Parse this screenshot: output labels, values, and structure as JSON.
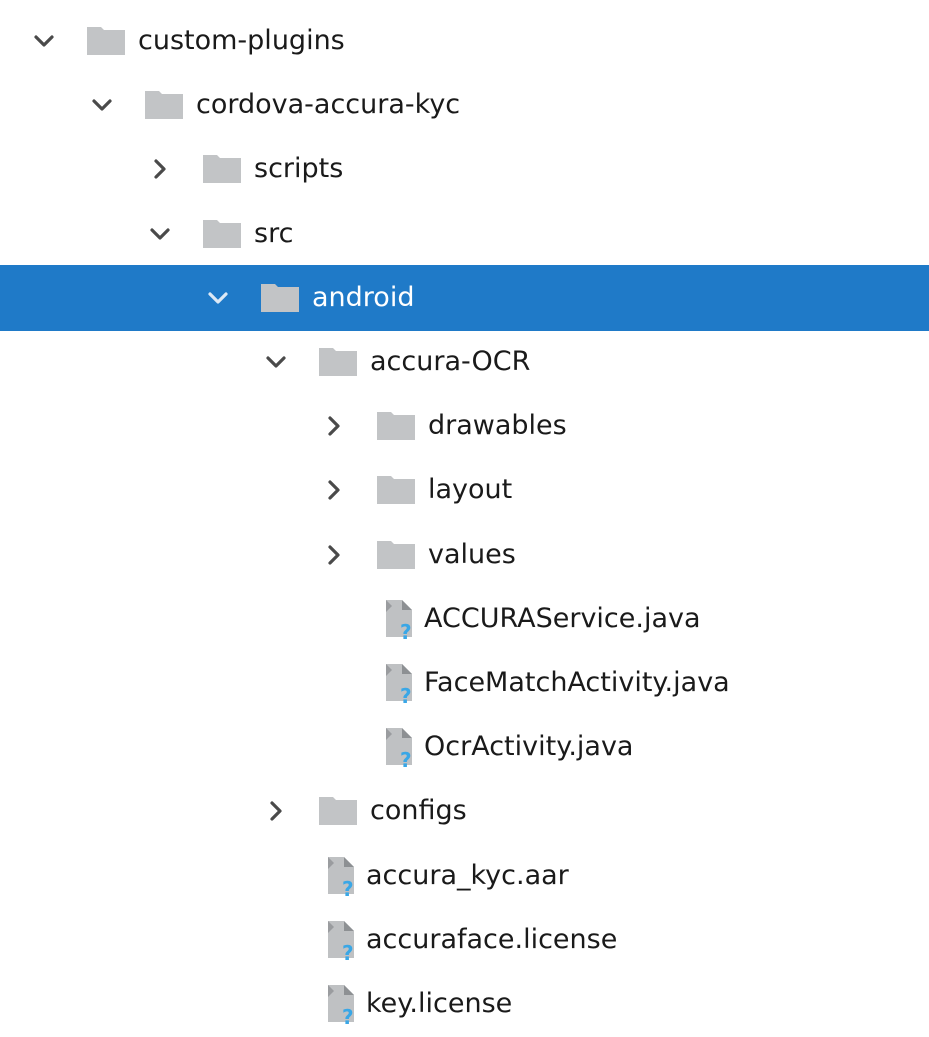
{
  "tree": {
    "selected_index": 4,
    "nodes": [
      {
        "label": "custom-plugins",
        "depth": 0,
        "kind": "folder",
        "state": "expanded"
      },
      {
        "label": "cordova-accura-kyc",
        "depth": 1,
        "kind": "folder",
        "state": "expanded"
      },
      {
        "label": "scripts",
        "depth": 2,
        "kind": "folder",
        "state": "collapsed"
      },
      {
        "label": "src",
        "depth": 2,
        "kind": "folder",
        "state": "expanded"
      },
      {
        "label": "android",
        "depth": 3,
        "kind": "folder",
        "state": "expanded"
      },
      {
        "label": "accura-OCR",
        "depth": 4,
        "kind": "folder",
        "state": "expanded"
      },
      {
        "label": "drawables",
        "depth": 5,
        "kind": "folder",
        "state": "collapsed"
      },
      {
        "label": "layout",
        "depth": 5,
        "kind": "folder",
        "state": "collapsed"
      },
      {
        "label": "values",
        "depth": 5,
        "kind": "folder",
        "state": "collapsed"
      },
      {
        "label": "ACCURAService.java",
        "depth": 5,
        "kind": "file",
        "state": "none"
      },
      {
        "label": "FaceMatchActivity.java",
        "depth": 5,
        "kind": "file",
        "state": "none"
      },
      {
        "label": "OcrActivity.java",
        "depth": 5,
        "kind": "file",
        "state": "none"
      },
      {
        "label": "configs",
        "depth": 4,
        "kind": "folder",
        "state": "collapsed"
      },
      {
        "label": "accura_kyc.aar",
        "depth": 4,
        "kind": "file",
        "state": "none"
      },
      {
        "label": "accuraface.license",
        "depth": 4,
        "kind": "file",
        "state": "none"
      },
      {
        "label": "key.license",
        "depth": 4,
        "kind": "file",
        "state": "none"
      }
    ]
  },
  "icons": {
    "expanded": "chevron-down-icon",
    "collapsed": "chevron-right-icon",
    "folder": "folder-icon",
    "file": "unknown-file-icon"
  },
  "colors": {
    "selection_bg": "#1f7ac8",
    "folder": "#c2c4c6",
    "file_badge": "#3aa7e6",
    "text": "#1a1a1a",
    "text_selected": "#ffffff"
  }
}
